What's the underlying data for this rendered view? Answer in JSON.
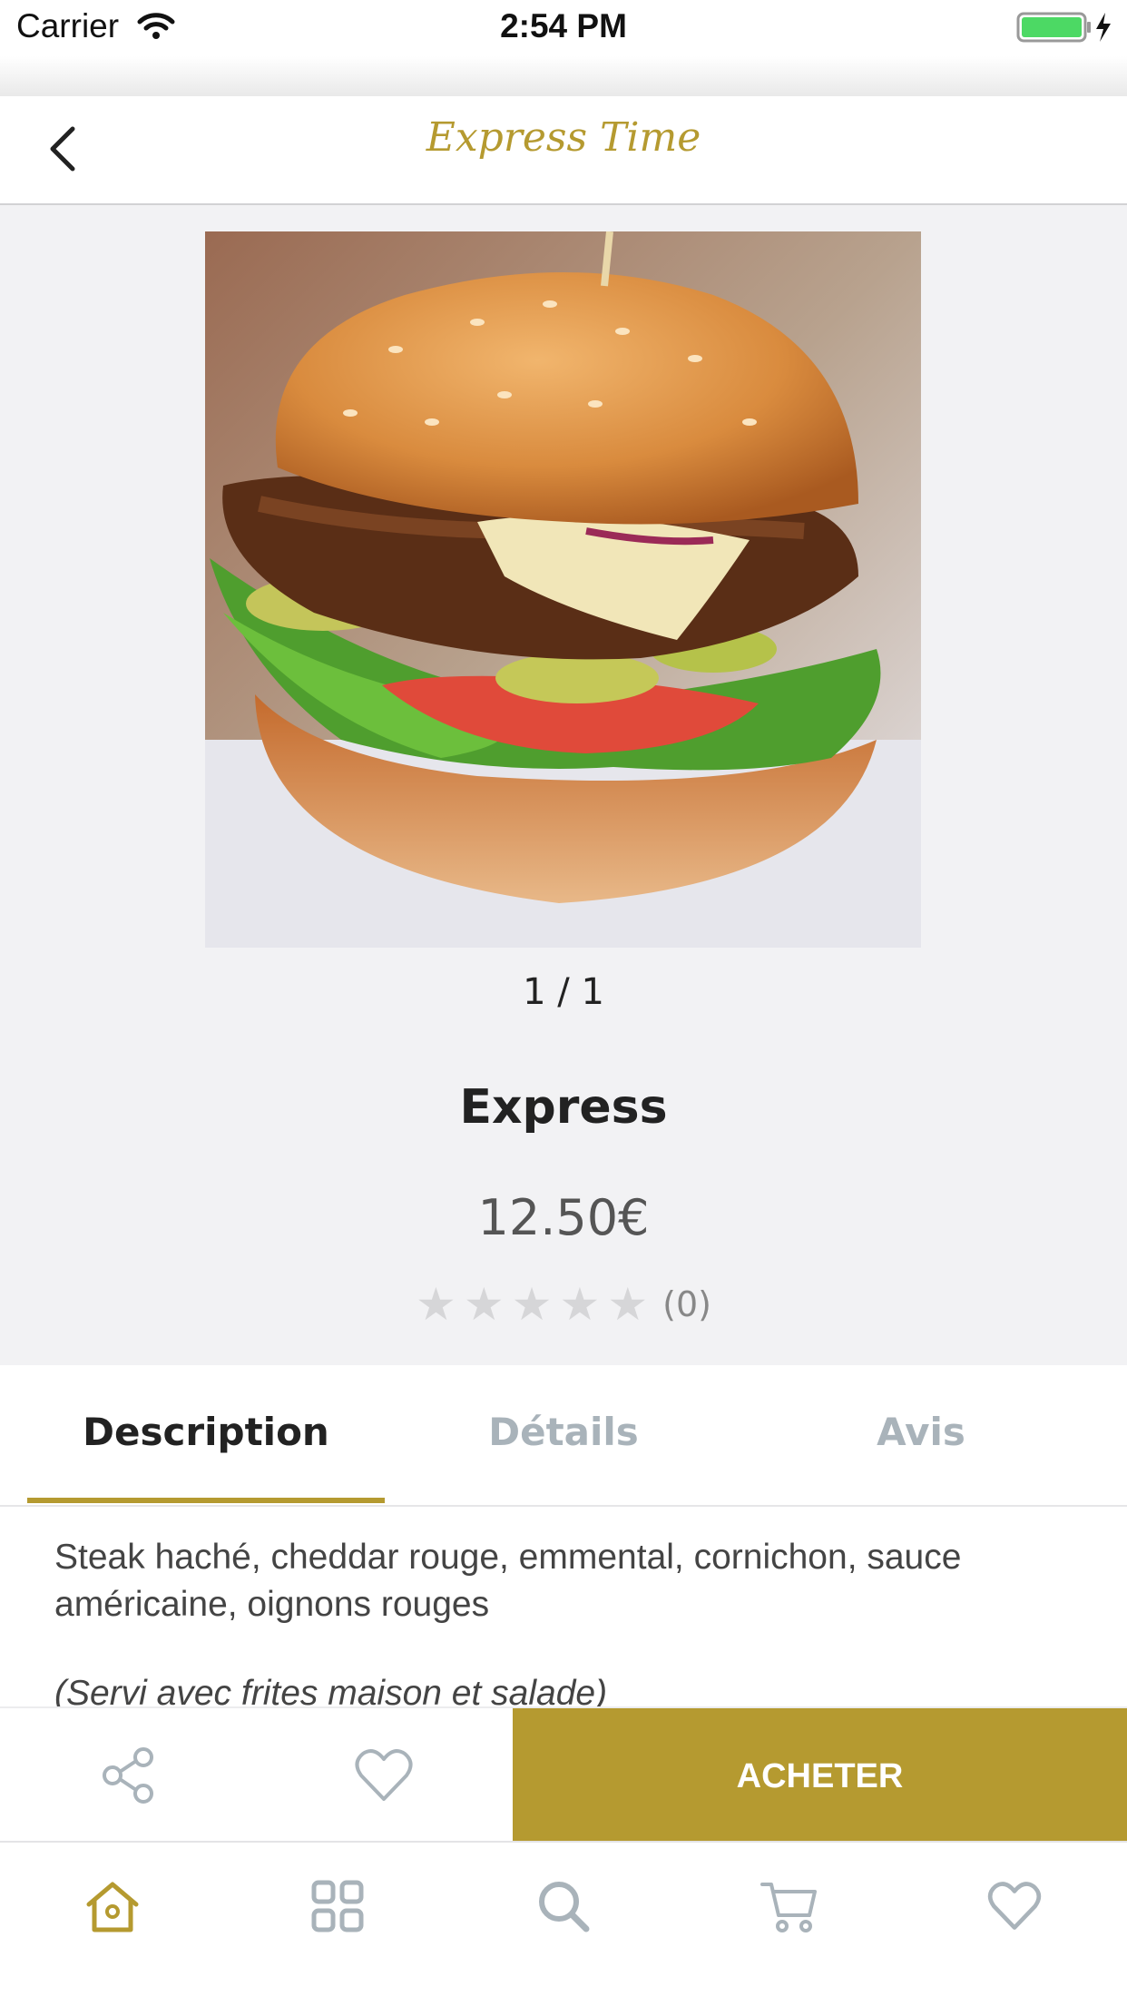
{
  "status_bar": {
    "carrier": "Carrier",
    "time": "2:54 PM"
  },
  "nav": {
    "title": "Express Time",
    "back_icon": "chevron-left-icon"
  },
  "product": {
    "image_counter": "1 / 1",
    "name": "Express",
    "price": "12.50€",
    "rating": {
      "stars": 0,
      "max": 5,
      "count_label": "(0)"
    }
  },
  "tabs": [
    {
      "label": "Description",
      "active": true
    },
    {
      "label": "Détails",
      "active": false
    },
    {
      "label": "Avis",
      "active": false
    }
  ],
  "description": {
    "text": "Steak haché, cheddar rouge, emmental, cornichon, sauce américaine, oignons rouges",
    "note": "(Servi avec frites maison et salade)"
  },
  "actions": {
    "share_icon": "share-icon",
    "favorite_icon": "heart-icon",
    "buy_label": "ACHETER"
  },
  "tabbar": [
    {
      "icon": "home-icon",
      "active": true
    },
    {
      "icon": "grid-icon",
      "active": false
    },
    {
      "icon": "search-icon",
      "active": false
    },
    {
      "icon": "cart-icon",
      "active": false
    },
    {
      "icon": "heart-icon",
      "active": false
    }
  ],
  "colors": {
    "accent": "#b59a30",
    "inactive": "#a9b3ba",
    "background_gray": "#f2f2f4"
  }
}
